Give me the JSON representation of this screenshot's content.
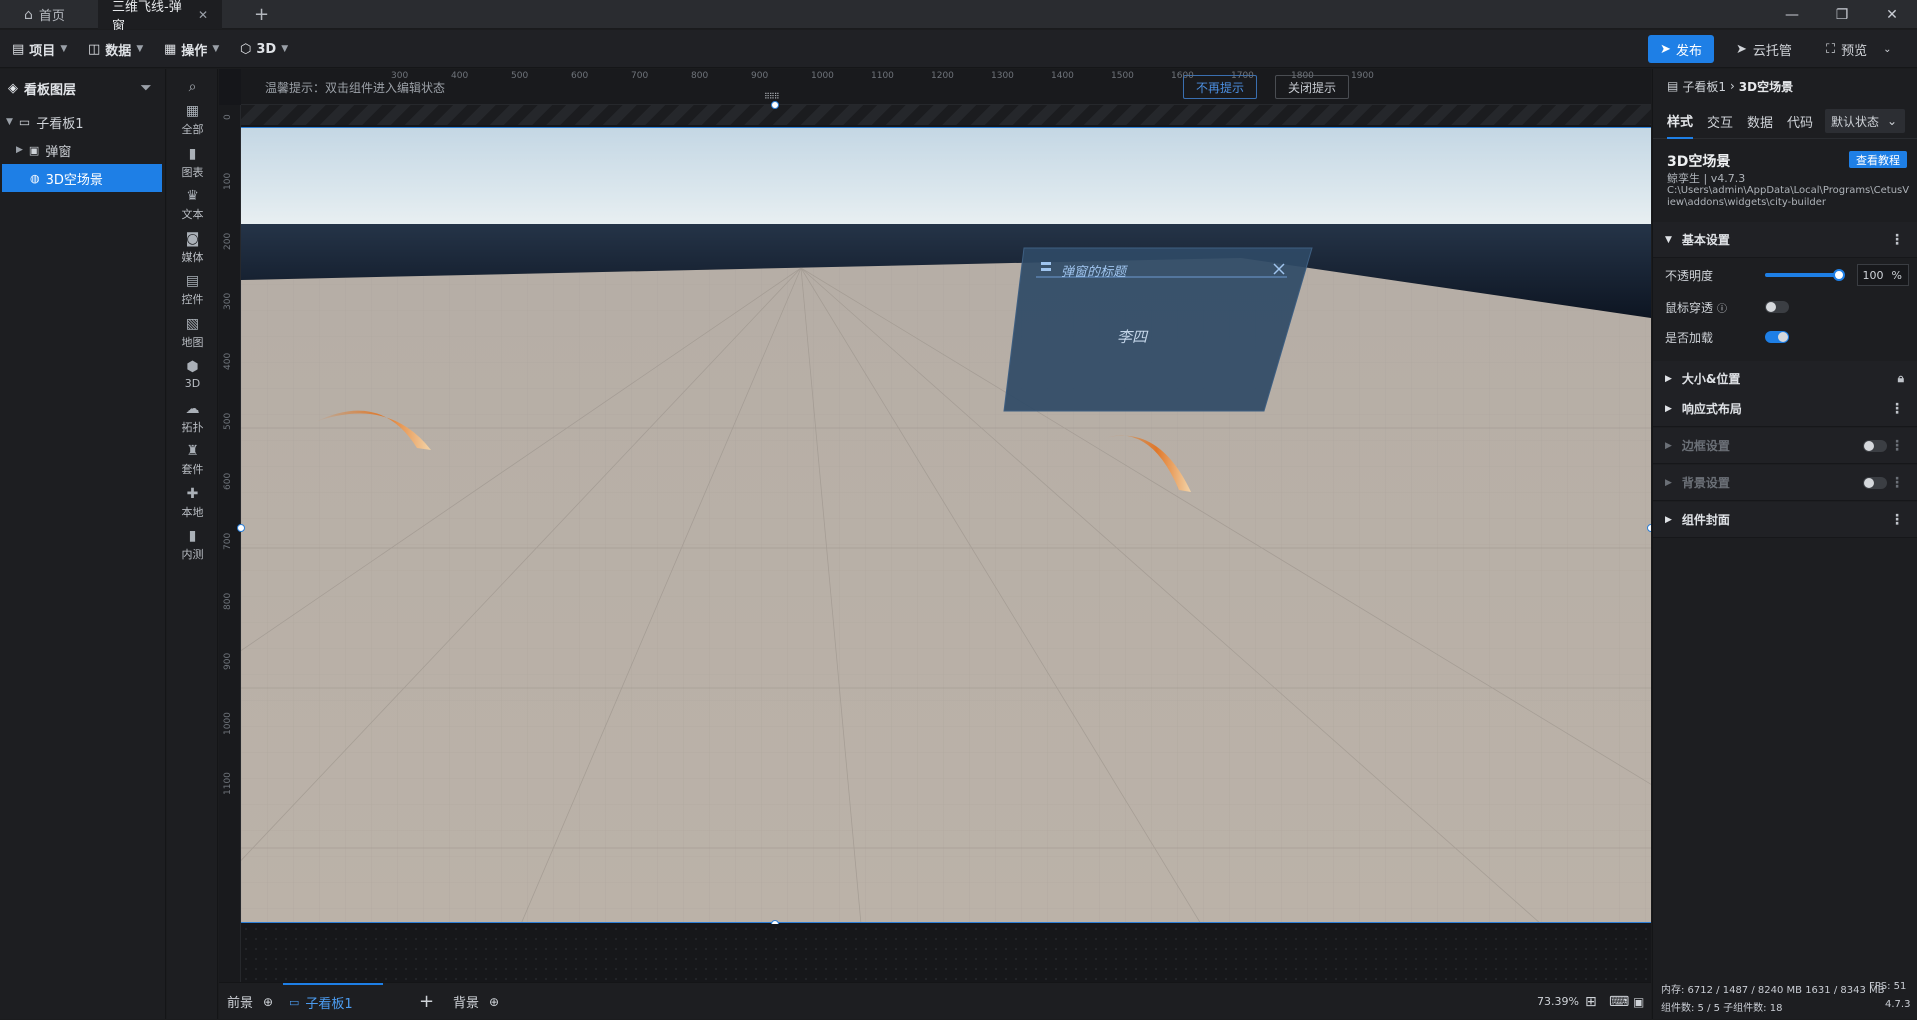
{
  "titlebar": {
    "home_tab": "首页",
    "active_tab": "三维飞线-弹窗",
    "new_tab": "+"
  },
  "toolbar": {
    "menus": [
      "项目",
      "数据",
      "操作",
      "3D"
    ],
    "publish": "发布",
    "cloud": "云托管",
    "preview": "预览"
  },
  "layers": {
    "title": "看板图层",
    "items": [
      {
        "label": "子看板1"
      },
      {
        "label": "弹窗"
      },
      {
        "label": "3D空场景"
      }
    ]
  },
  "components": [
    "全部",
    "图表",
    "文本",
    "媒体",
    "控件",
    "地图",
    "3D",
    "拓扑",
    "套件",
    "本地",
    "内测"
  ],
  "canvas": {
    "hint": "温馨提示：双击组件进入编辑状态",
    "no_more": "不再提示",
    "close_hint": "关闭提示",
    "ruler_x": [
      "300",
      "400",
      "500",
      "600",
      "700",
      "800",
      "900",
      "1000",
      "1100",
      "1200",
      "1300",
      "1400",
      "1500",
      "1600",
      "1700",
      "1800",
      "1900"
    ],
    "ruler_y": [
      "0",
      "100",
      "200",
      "300",
      "400",
      "500",
      "600",
      "700",
      "800",
      "900",
      "1000",
      "1100"
    ],
    "popup_title": "弹窗的标题",
    "popup_body": "李四"
  },
  "bottombar": {
    "front": "前景",
    "board": "子看板1",
    "add": "+",
    "back": "背景",
    "zoom": "73.39%"
  },
  "rpanel": {
    "breadcrumb_parent": "子看板1",
    "breadcrumb_child": "3D空场景",
    "tabs": [
      "样式",
      "交互",
      "数据",
      "代码"
    ],
    "state": "默认状态",
    "widget_name": "3D空场景",
    "tutorial": "查看教程",
    "author": "鲸孪生 | v4.7.3",
    "path": "C:\\Users\\admin\\AppData\\Local\\Programs\\CetusView\\addons\\widgets\\city-builder",
    "sections": {
      "basic": "基本设置",
      "size": "大小&位置",
      "responsive": "响应式布局",
      "border": "边框设置",
      "background": "背景设置",
      "cover": "组件封面"
    },
    "opacity_label": "不透明度",
    "opacity_value": "100",
    "opacity_unit": "%",
    "opacity_level": 1.0,
    "mouse_through_label": "鼠标穿透",
    "mouse_through_on": false,
    "load_label": "是否加载",
    "load_on": true,
    "memory": "内存: 6712 / 1487 / 8240 MB  1631 / 8343 MB",
    "fps": "FPS: 51",
    "counts": "组件数: 5 / 5   子组件数: 18",
    "version": "4.7.3"
  },
  "colors": {
    "accent": "#1e7fe6",
    "sky_top": "#dbe7ef",
    "floor": "#b9b0a6",
    "popup": "#2f4a66"
  }
}
